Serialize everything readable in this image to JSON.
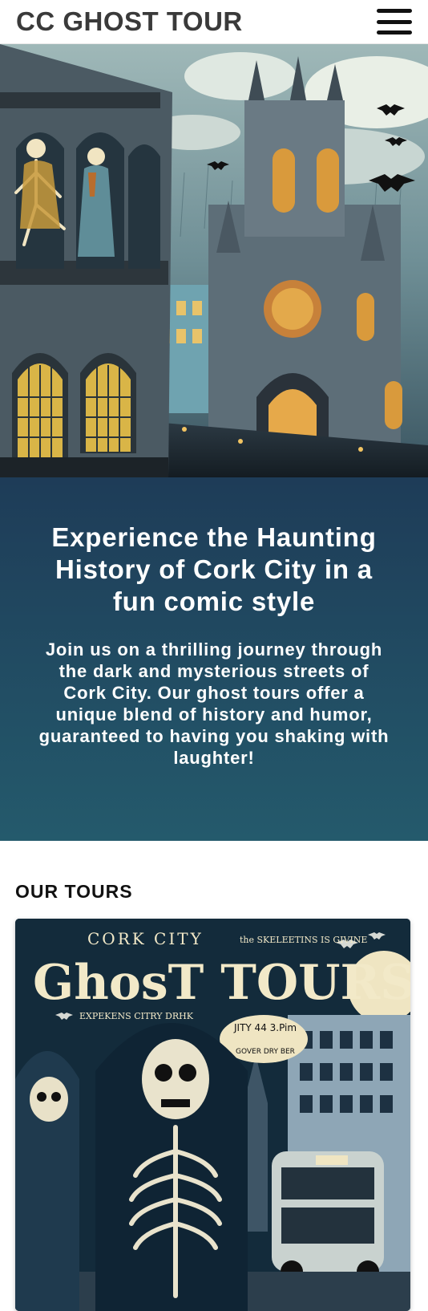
{
  "header": {
    "brand": "CC GHOST TOUR",
    "menu_icon": "hamburger-menu-icon"
  },
  "hero": {
    "image": "gothic-cathedral-skeletons-illustration"
  },
  "intro": {
    "heading": "Experience the Haunting History of Cork City in a fun comic style",
    "description": "Join us on a thrilling journey through the dark and mysterious streets of Cork City. Our ghost tours offer a unique blend of history and humor, guaranteed to having you shaking with laughter!",
    "colors": {
      "top": "#1e3c58",
      "bottom": "#245a6c"
    }
  },
  "tours": {
    "heading": "OUR TOURS",
    "card": {
      "image": "ghost-tours-poster-illustration",
      "poster_top": "CORK CITY",
      "poster_title": "GhosT TOURS",
      "poster_side": "the SKELEETINS IS GIVINE",
      "poster_sub": "EXPEKENS CITRY DRHK",
      "poster_bubble_1": "JITY 44 3.Pim",
      "poster_bubble_2": "GOVER DRY BER"
    }
  }
}
